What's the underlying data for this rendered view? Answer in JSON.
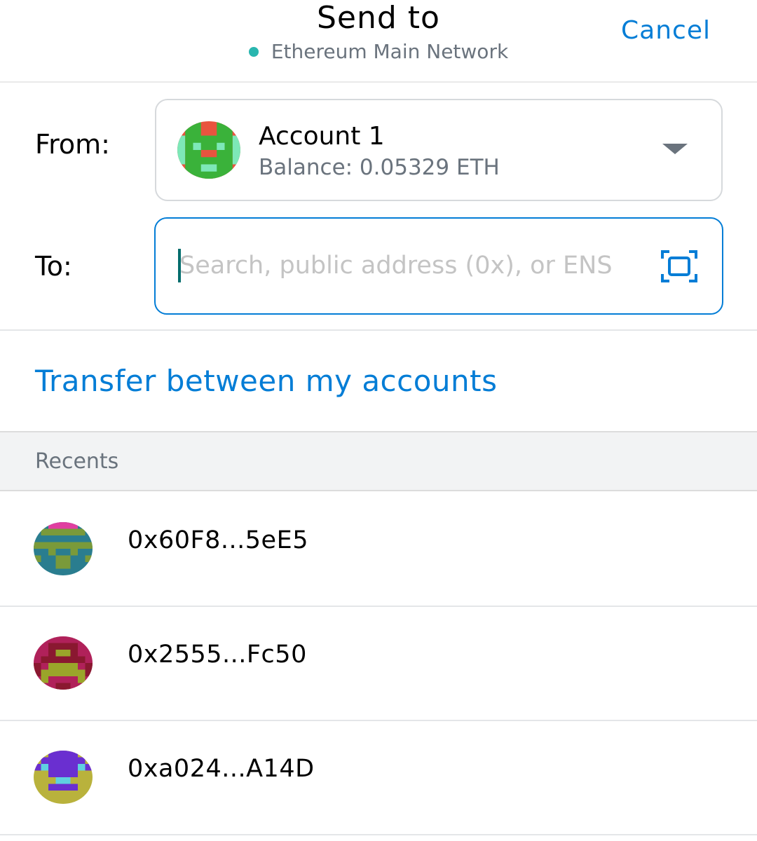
{
  "header": {
    "title": "Send to",
    "network": "Ethereum Main Network",
    "network_dot_color": "#29b6af",
    "cancel_label": "Cancel"
  },
  "from": {
    "label": "From:",
    "account_name": "Account 1",
    "balance": "Balance: 0.05329 ETH",
    "avatar_icon": "account-identicon",
    "dropdown_icon": "caret-down-icon"
  },
  "to": {
    "label": "To:",
    "placeholder": "Search, public address (0x), or ENS",
    "value": "",
    "scan_icon": "qr-scan-icon"
  },
  "transfer_link": "Transfer between my accounts",
  "recents": {
    "title": "Recents",
    "items": [
      {
        "address": "0x60F8...5eE5",
        "avatar_icon": "identicon-teal"
      },
      {
        "address": "0x2555...Fc50",
        "avatar_icon": "identicon-maroon"
      },
      {
        "address": "0xa024...A14D",
        "avatar_icon": "identicon-purple"
      }
    ]
  },
  "colors": {
    "accent": "#037dd6",
    "muted_text": "#6a737d",
    "border": "#d6d9dc",
    "recents_bg": "#f2f3f4"
  }
}
